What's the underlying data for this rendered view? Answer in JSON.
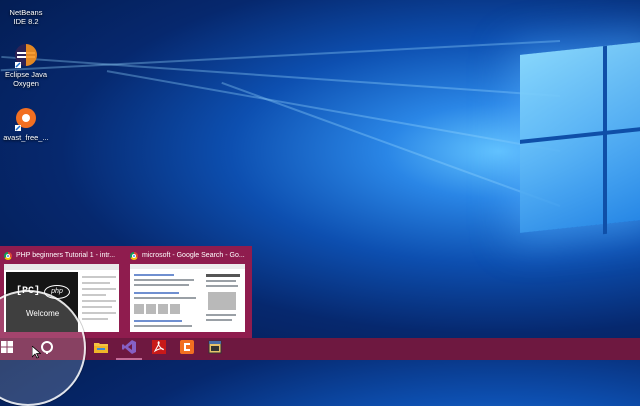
{
  "desktop": {
    "icons": [
      {
        "id": "netbeans",
        "label": "NetBeans IDE 8.2",
        "icon": "netbeans-icon"
      },
      {
        "id": "eclipse",
        "label": "Eclipse Java Oxygen",
        "icon": "eclipse-icon"
      },
      {
        "id": "avast",
        "label": "avast_free_...",
        "icon": "avast-icon"
      }
    ]
  },
  "previews": [
    {
      "title": "PHP beginners Tutorial 1 - intr...",
      "icon": "chrome-icon",
      "page_logo": "[PC]",
      "page_badge": "php",
      "page_text": "Welcome"
    },
    {
      "title": "microsoft - Google Search - Go...",
      "icon": "chrome-icon"
    }
  ],
  "taskbar": {
    "buttons": [
      {
        "name": "start",
        "icon": "windows-logo-icon"
      },
      {
        "name": "search",
        "icon": "search-icon"
      },
      {
        "name": "file-explorer",
        "icon": "folder-icon"
      },
      {
        "name": "visual-studio",
        "icon": "visual-studio-icon"
      },
      {
        "name": "acrobat",
        "icon": "acrobat-icon"
      },
      {
        "name": "app-orange",
        "icon": "orange-app-icon"
      },
      {
        "name": "app-window",
        "icon": "window-app-icon"
      }
    ]
  },
  "colors": {
    "taskbar": "#6e1840",
    "preview_bg": "#8f1c4e",
    "desktop_glow": "#63c4ff"
  }
}
